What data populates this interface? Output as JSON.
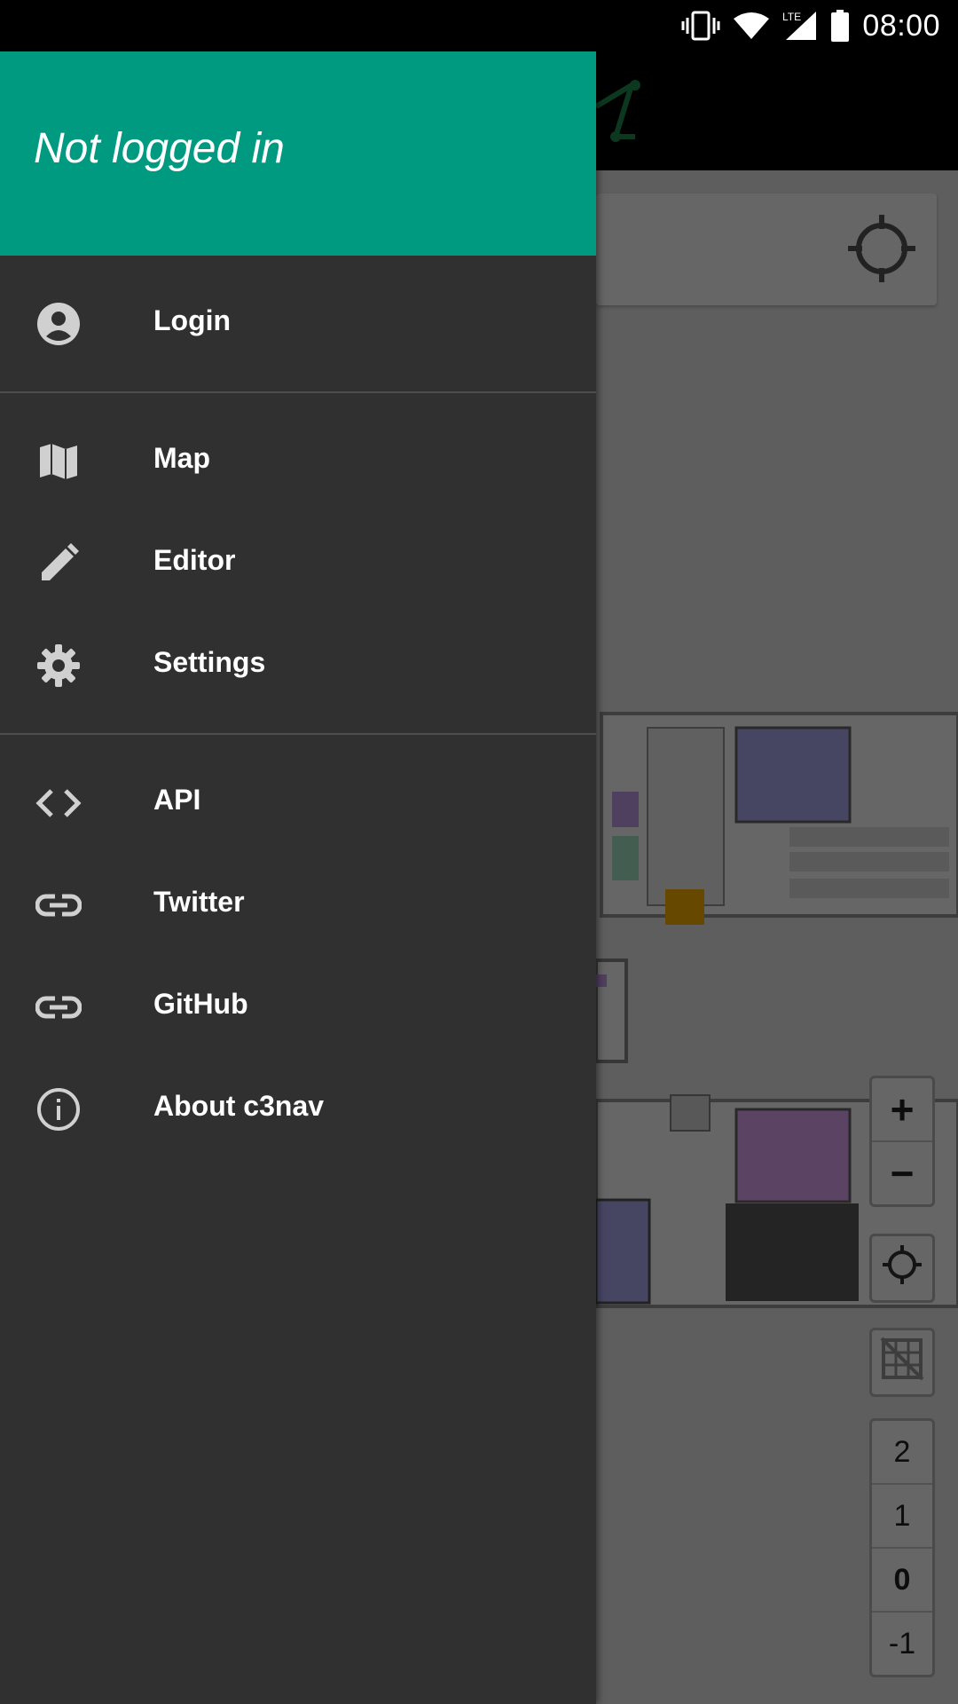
{
  "status_bar": {
    "time": "08:00",
    "network": "LTE",
    "icons": [
      "vibrate-icon",
      "wifi-icon",
      "signal-icon",
      "battery-icon"
    ]
  },
  "drawer": {
    "header": {
      "status_text": "Not logged in",
      "color": "#009a80"
    },
    "sections": [
      {
        "items": [
          {
            "label": "Login",
            "icon": "account-circle-icon"
          }
        ]
      },
      {
        "items": [
          {
            "label": "Map",
            "icon": "map-icon"
          },
          {
            "label": "Editor",
            "icon": "pencil-icon"
          },
          {
            "label": "Settings",
            "icon": "gear-icon"
          }
        ]
      },
      {
        "items": [
          {
            "label": "API",
            "icon": "code-icon"
          },
          {
            "label": "Twitter",
            "icon": "link-icon"
          },
          {
            "label": "GitHub",
            "icon": "link-icon"
          },
          {
            "label": "About c3nav",
            "icon": "info-icon"
          }
        ]
      }
    ]
  },
  "map_controls": {
    "zoom_in": "+",
    "zoom_out": "−",
    "levels": [
      "2",
      "1",
      "0",
      "-1"
    ],
    "active_level": "0"
  },
  "colors": {
    "drawer_bg": "#303030",
    "accent": "#009a80"
  }
}
